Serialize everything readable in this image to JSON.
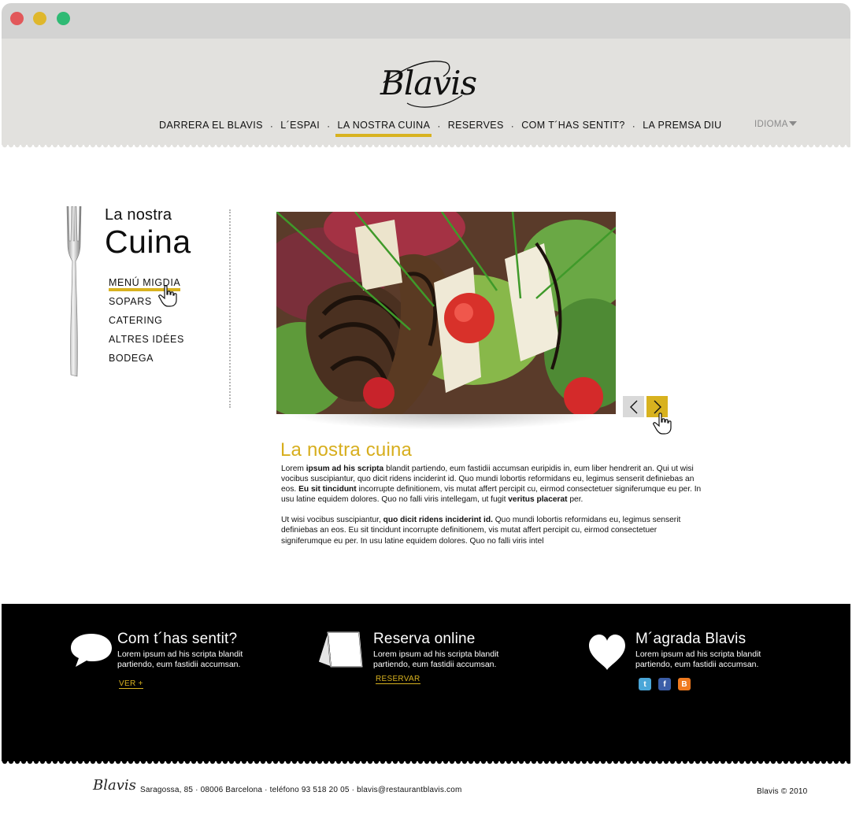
{
  "window": {
    "controls": [
      "close",
      "minimize",
      "maximize"
    ]
  },
  "brand": {
    "logo_text": "Blavis",
    "accent_color": "#d8b21f",
    "header_bg": "#e2e1de"
  },
  "nav": {
    "items": [
      {
        "label": "DARRERA EL BLAVIS",
        "active": false
      },
      {
        "label": "L´ESPAI",
        "active": false
      },
      {
        "label": "LA NOSTRA CUINA",
        "active": true
      },
      {
        "label": "RESERVES",
        "active": false
      },
      {
        "label": "COM T´HAS SENTIT?",
        "active": false
      },
      {
        "label": "LA PREMSA DIU",
        "active": false
      }
    ],
    "separator": "·",
    "language_label": "IDIOMA"
  },
  "sidebar": {
    "title_small": "La nostra",
    "title_big": "Cuina",
    "items": [
      {
        "label": "MENÚ MIGDIA",
        "active": true
      },
      {
        "label": "SOPARS",
        "active": false
      },
      {
        "label": "CATERING",
        "active": false
      },
      {
        "label": "ALTRES IDÉES",
        "active": false
      },
      {
        "label": "BODEGA",
        "active": false
      }
    ]
  },
  "gallery": {
    "prev_icon": "chevron-left-icon",
    "next_icon": "chevron-right-icon"
  },
  "article": {
    "title": "La nostra cuina",
    "p1": [
      {
        "t": "Lorem ",
        "b": false
      },
      {
        "t": "ipsum ad his scripta",
        "b": true
      },
      {
        "t": " blandit partiendo, eum fastidii accumsan euripidis in, eum liber hendrerit an. Qui ut wisi vocibus suscipiantur, quo dicit ridens inciderint id. Quo mundi lobortis reformidans eu, legimus senserit definiebas an eos. ",
        "b": false
      },
      {
        "t": "Eu sit tincidunt",
        "b": true
      },
      {
        "t": " incorrupte definitionem, vis mutat affert percipit cu, eirmod consectetuer signiferumque eu per. In usu latine equidem dolores. Quo no falli viris intellegam, ut fugit ",
        "b": false
      },
      {
        "t": "veritus placerat",
        "b": true
      },
      {
        "t": " per.",
        "b": false
      }
    ],
    "p2": [
      {
        "t": "Ut wisi vocibus suscipiantur, ",
        "b": false
      },
      {
        "t": "quo dicit ridens inciderint id.",
        "b": true
      },
      {
        "t": " Quo mundi lobortis reformidans eu, legimus senserit definiebas an eos. Eu sit tincidunt incorrupte definitionem, vis mutat affert percipit cu, eirmod consectetuer signiferumque eu per. In usu latine equidem dolores. Quo no falli viris intel",
        "b": false
      }
    ]
  },
  "features": {
    "feedback": {
      "title": "Com t´has sentit?",
      "text_line1": "Lorem ipsum ad his scripta blandit",
      "text_line2": "partiendo, eum fastidii accumsan.",
      "link": "VER +",
      "icon": "speech-bubble-icon"
    },
    "booking": {
      "title": "Reserva online",
      "text_line1": "Lorem ipsum ad his scripta blandit",
      "text_line2": "partiendo, eum fastidii accumsan.",
      "link": "RESERVAR",
      "icon": "reservation-card-icon"
    },
    "like": {
      "title": "M´agrada Blavis",
      "text_line1": "Lorem ipsum ad his scripta blandit",
      "text_line2": "partiendo, eum fastidii accumsan.",
      "icon": "heart-icon",
      "social": [
        {
          "name": "twitter-icon",
          "color": "#4aa6d8"
        },
        {
          "name": "facebook-icon",
          "color": "#3b5ea8"
        },
        {
          "name": "blogger-icon",
          "color": "#f07a1f"
        }
      ]
    }
  },
  "footer": {
    "logo_text": "Blavis",
    "address": "Saragossa, 85 · 08006 Barcelona · teléfono 93 518 20 05 · blavis@restaurantblavis.com",
    "copyright": "Blavis © 2010"
  }
}
